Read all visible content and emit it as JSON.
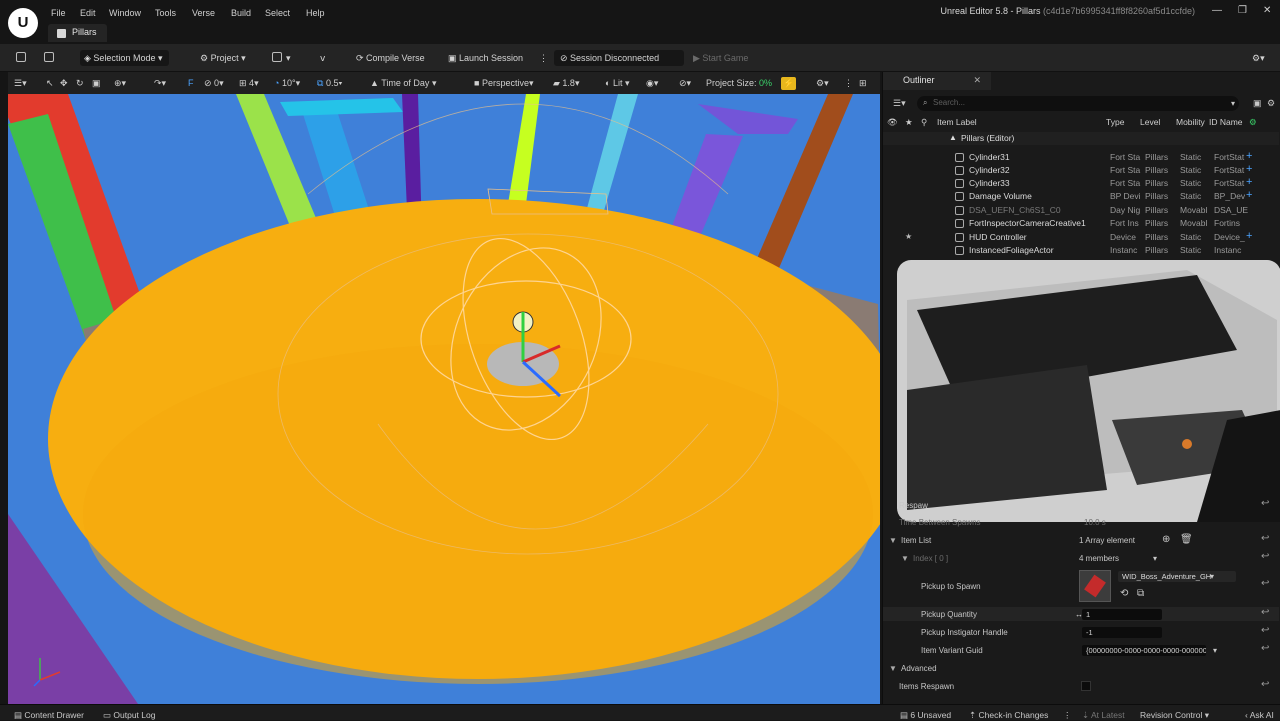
{
  "app": {
    "logo": "U",
    "menu": [
      "File",
      "Edit",
      "Window",
      "Tools",
      "Verse",
      "Build",
      "Select",
      "Help"
    ],
    "document_tab": "Pillars",
    "window_title": "Unreal Editor 5.8 - Pillars",
    "window_hash": "(c4d1e7b6995341ff8f8260af5d1ccfde)"
  },
  "toolbar": {
    "selection_mode": "Selection Mode",
    "project": "Project",
    "compile_verse": "Compile Verse",
    "launch_session": "Launch Session",
    "session_status": "Session Disconnected",
    "start_game": "Start Game"
  },
  "viewport_bar": {
    "rotate_snap": "0",
    "grid_snap": "4",
    "angle_snap": "10°",
    "scale_snap": "0.5",
    "time_of_day": "Time of Day",
    "perspective": "Perspective",
    "camera_speed": "1.8",
    "lit": "Lit",
    "project_size_label": "Project Size:",
    "project_size_value": "0%"
  },
  "outliner": {
    "tab_label": "Outliner",
    "search_placeholder": "Search...",
    "columns": {
      "item_label": "Item Label",
      "type": "Type",
      "level": "Level",
      "mobility": "Mobility",
      "id_name": "ID Name"
    },
    "root": "Pillars (Editor)",
    "rows": [
      {
        "label": "Cylinder31",
        "type": "Fort Sta",
        "level": "Pillars",
        "mobility": "Static",
        "id": "FortStat",
        "plus": "+",
        "star": ""
      },
      {
        "label": "Cylinder32",
        "type": "Fort Sta",
        "level": "Pillars",
        "mobility": "Static",
        "id": "FortStat",
        "plus": "+",
        "star": ""
      },
      {
        "label": "Cylinder33",
        "type": "Fort Sta",
        "level": "Pillars",
        "mobility": "Static",
        "id": "FortStat",
        "plus": "+",
        "star": ""
      },
      {
        "label": "Damage Volume",
        "type": "BP Devi",
        "level": "Pillars",
        "mobility": "Static",
        "id": "BP_Dev",
        "plus": "+",
        "star": ""
      },
      {
        "label": "DSA_UEFN_Ch6S1_C0",
        "type": "Day Nig",
        "level": "Pillars",
        "mobility": "Movabl",
        "id": "DSA_UE",
        "plus": "",
        "star": ""
      },
      {
        "label": "FortInspectorCameraCreative1",
        "type": "Fort Ins",
        "level": "Pillars",
        "mobility": "Movabl",
        "id": "Fortins",
        "plus": "",
        "star": ""
      },
      {
        "label": "HUD Controller",
        "type": "Device",
        "level": "Pillars",
        "mobility": "Static",
        "id": "Device_",
        "plus": "+",
        "star": "★"
      },
      {
        "label": "InstancedFoliageActor",
        "type": "Instanc",
        "level": "Pillars",
        "mobility": "Static",
        "id": "Instanc",
        "plus": "",
        "star": ""
      }
    ]
  },
  "details": {
    "respawn_label": "Respaw",
    "time_between_spawns_label": "Time Between Spawns",
    "time_between_spawns_value": "10.0 s",
    "item_list_label": "Item List",
    "item_list_value": "1 Array element",
    "index_label": "Index [ 0 ]",
    "index_value": "4 members",
    "pickup_to_spawn_label": "Pickup to Spawn",
    "pickup_asset": "WID_Boss_Adventure_GH",
    "pickup_quantity_label": "Pickup Quantity",
    "pickup_quantity_value": "1",
    "instigator_label": "Pickup Instigator Handle",
    "instigator_value": "-1",
    "variant_guid_label": "Item Variant Guid",
    "variant_guid_value": "{00000000-0000-0000-0000-00000000",
    "advanced_label": "Advanced",
    "items_respawn_label": "Items Respawn"
  },
  "statusbar": {
    "content_drawer": "Content Drawer",
    "output_log": "Output Log",
    "unsaved": "6 Unsaved",
    "check_in": "Check-in Changes",
    "at_latest": "At Latest",
    "revision_control": "Revision Control",
    "ask_ai": "Ask AI"
  }
}
